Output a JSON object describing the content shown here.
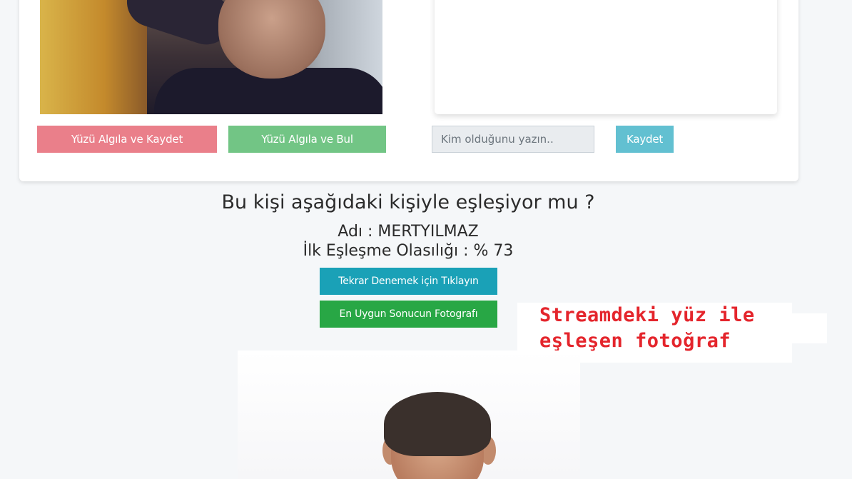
{
  "left_buttons": {
    "detect_save": "Yüzü Algıla ve Kaydet",
    "detect_find": "Yüzü Algıla ve Bul"
  },
  "name_form": {
    "placeholder": "Kim olduğunu yazın..",
    "value": "",
    "save_label": "Kaydet"
  },
  "result": {
    "question": "Bu kişi aşağıdaki kişiyle eşleşiyor mu ?",
    "name_line": "Adı : MERTYILMAZ",
    "probability_line": "İlk Eşleşme Olasılığı : % 73",
    "retry_label": "Tekrar Denemek için Tıklayın",
    "best_photo_label": "En Uygun Sonucun Fotografı"
  },
  "annotation": {
    "line1": "Streamdeki yüz ile",
    "line2": "eşleşen fotoğraf"
  },
  "colors": {
    "detect_save": "#ea7f8a",
    "detect_find": "#72c585",
    "save": "#62c0d1",
    "retry": "#1aa1b7",
    "best_photo": "#28a745",
    "annotation": "#e4252c"
  }
}
